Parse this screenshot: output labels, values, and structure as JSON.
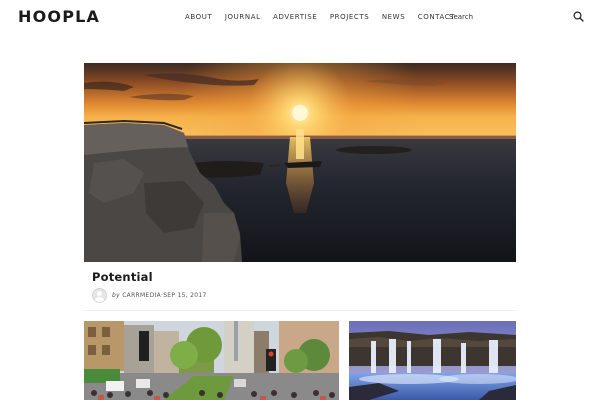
{
  "site": {
    "logo": "HOOPLA"
  },
  "nav": {
    "items": [
      {
        "label": "ABOUT"
      },
      {
        "label": "JOURNAL"
      },
      {
        "label": "ADVERTISE"
      },
      {
        "label": "PROJECTS"
      },
      {
        "label": "NEWS"
      },
      {
        "label": "CONTACT"
      }
    ]
  },
  "search": {
    "placeholder": "Search",
    "value": ""
  },
  "featured_post": {
    "title": "Potential",
    "by_label": "by",
    "author": "CARRMEDIA",
    "separator": " · ",
    "date": "SEP 15, 2017"
  },
  "icons": {
    "search": "search-icon",
    "avatar": "user-avatar-icon"
  },
  "colors": {
    "text": "#1a1a1a",
    "background": "#ffffff",
    "sunset": "#f0a030"
  }
}
